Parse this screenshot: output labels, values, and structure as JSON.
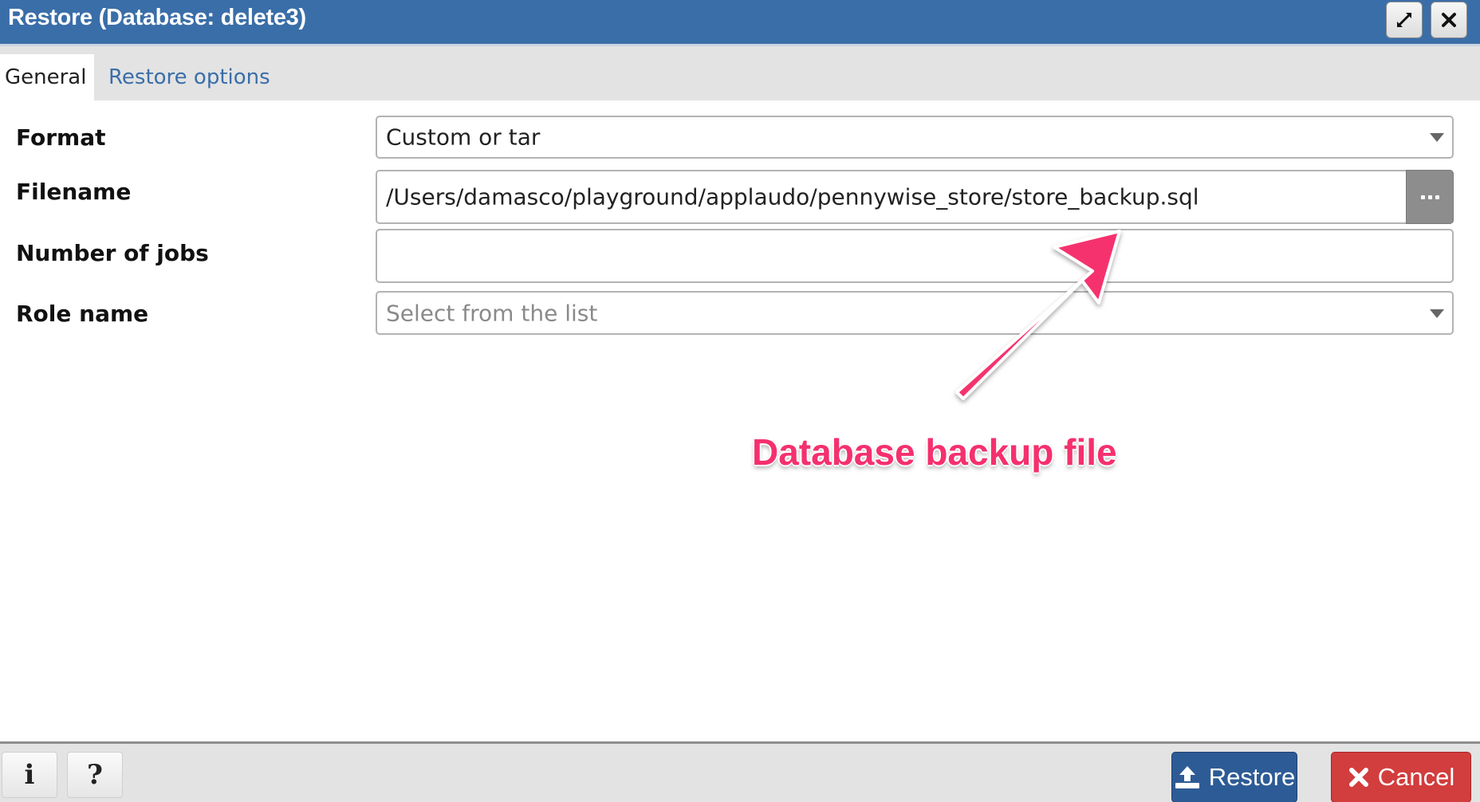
{
  "window": {
    "title": "Restore (Database: delete3)",
    "maximize_icon": "expand-icon",
    "close_icon": "close-icon"
  },
  "tabs": [
    {
      "label": "General",
      "active": true
    },
    {
      "label": "Restore options",
      "active": false
    }
  ],
  "form": {
    "format": {
      "label": "Format",
      "value": "Custom or tar"
    },
    "filename": {
      "label": "Filename",
      "value": "/Users/damasco/playground/applaudo/pennywise_store/store_backup.sql",
      "browse_icon": "ellipsis-icon"
    },
    "jobs": {
      "label": "Number of jobs",
      "value": ""
    },
    "role": {
      "label": "Role name",
      "placeholder": "Select from the list"
    }
  },
  "annotation": {
    "text": "Database backup file",
    "color": "#f5306e"
  },
  "footer": {
    "info_label": "i",
    "help_label": "?",
    "restore_label": "Restore",
    "cancel_label": "Cancel"
  },
  "colors": {
    "titlebar": "#3a6ea8",
    "tab_link": "#3a6ea8",
    "restore_button": "#2d5b96",
    "cancel_button": "#d23d3d"
  }
}
